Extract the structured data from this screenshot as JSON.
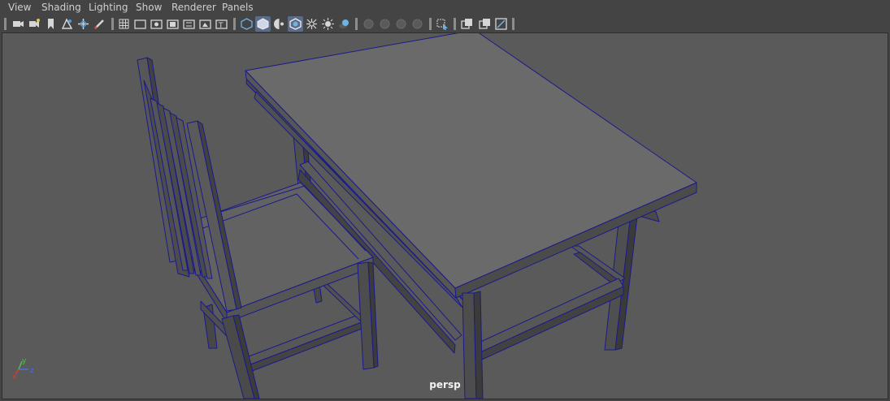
{
  "menu": {
    "items": [
      "View",
      "Shading",
      "Lighting",
      "Show",
      "Renderer",
      "Panels"
    ]
  },
  "toolbar": {
    "icons": [
      "select-camera-icon",
      "camera-attributes-icon",
      "bookmark-icon",
      "image-plane-icon",
      "2d-pan-zoom-icon",
      "grease-pencil-icon",
      "grid-icon",
      "film-gate-icon",
      "resolution-gate-icon",
      "gate-mask-icon",
      "field-chart-icon",
      "safe-action-icon",
      "safe-title-icon",
      "wireframe-icon",
      "smooth-shade-icon",
      "use-default-material-icon",
      "wireframe-on-shaded-icon",
      "xray-icon",
      "all-lights-icon",
      "shadows-icon",
      "screen-space-ao-icon",
      "motion-blur-icon",
      "multisample-aa-icon",
      "depth-of-field-icon",
      "isolate-select-icon",
      "xray-joints-icon",
      "xray-active-components-icon",
      "gamma-icon"
    ]
  },
  "viewport": {
    "camera_label": "persp",
    "axis_labels": {
      "x": "x",
      "y": "y",
      "z": "z"
    }
  },
  "colors": {
    "ui_background": "#444444",
    "viewport_background": "#5a5a5a",
    "selection_wire": "#1a1a8c",
    "active_toggle": "#5d6c86",
    "axis_x": "#d83a3a",
    "axis_y": "#4fc04f",
    "axis_z": "#4a6ee0"
  }
}
